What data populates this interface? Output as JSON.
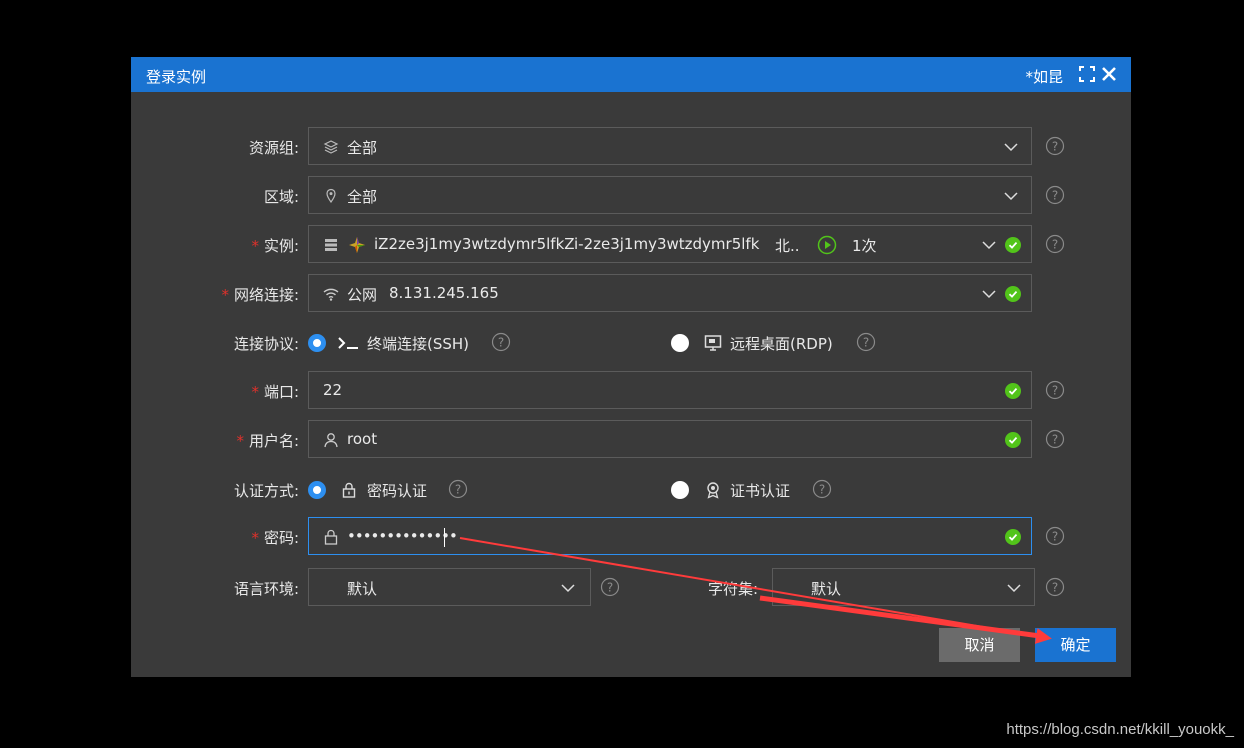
{
  "dialog": {
    "title": "登录实例",
    "user": "*如昆"
  },
  "form": {
    "resource_group": {
      "label": "资源组:",
      "value": "全部"
    },
    "region": {
      "label": "区域:",
      "value": "全部"
    },
    "instance": {
      "label": "实例:",
      "name": "iZ2ze3j1my3wtzdymr5lfkZ",
      "id": "i-2ze3j1my3wtzdymr5lfk",
      "region": "北..",
      "count": "1次"
    },
    "network": {
      "label": "网络连接:",
      "type": "公网",
      "ip": "8.131.245.165"
    },
    "protocol": {
      "label": "连接协议:",
      "ssh": "终端连接(SSH)",
      "rdp": "远程桌面(RDP)",
      "selected": "ssh"
    },
    "port": {
      "label": "端口:",
      "value": "22"
    },
    "username": {
      "label": "用户名:",
      "value": "root"
    },
    "auth": {
      "label": "认证方式:",
      "password": "密码认证",
      "certificate": "证书认证",
      "selected": "password"
    },
    "password": {
      "label": "密码:",
      "value": "••••••••••••••"
    },
    "locale": {
      "label": "语言环境:",
      "value": "默认"
    },
    "charset": {
      "label": "字符集:",
      "value": "默认"
    }
  },
  "buttons": {
    "cancel": "取消",
    "confirm": "确定"
  },
  "watermark": "https://blog.csdn.net/kkill_youokk_",
  "colors": {
    "accent": "#1a73d1",
    "success": "#52c41a",
    "required": "#e0312b",
    "annotation_arrow": "#ff3b3b"
  }
}
